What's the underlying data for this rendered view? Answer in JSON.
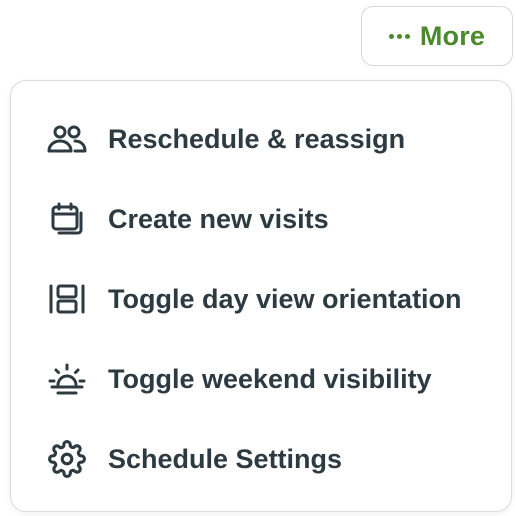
{
  "colors": {
    "accent": "#4a8a2a",
    "text": "#2d3a42",
    "border": "#d8d8d8"
  },
  "more_button": {
    "label": "More",
    "icon": "more-dots-icon"
  },
  "menu": {
    "items": [
      {
        "label": "Reschedule & reassign",
        "icon": "users-icon"
      },
      {
        "label": "Create new visits",
        "icon": "calendar-icon"
      },
      {
        "label": "Toggle day view orientation",
        "icon": "layout-rows-icon"
      },
      {
        "label": "Toggle weekend visibility",
        "icon": "sunrise-icon"
      },
      {
        "label": "Schedule Settings",
        "icon": "gear-icon"
      }
    ]
  }
}
